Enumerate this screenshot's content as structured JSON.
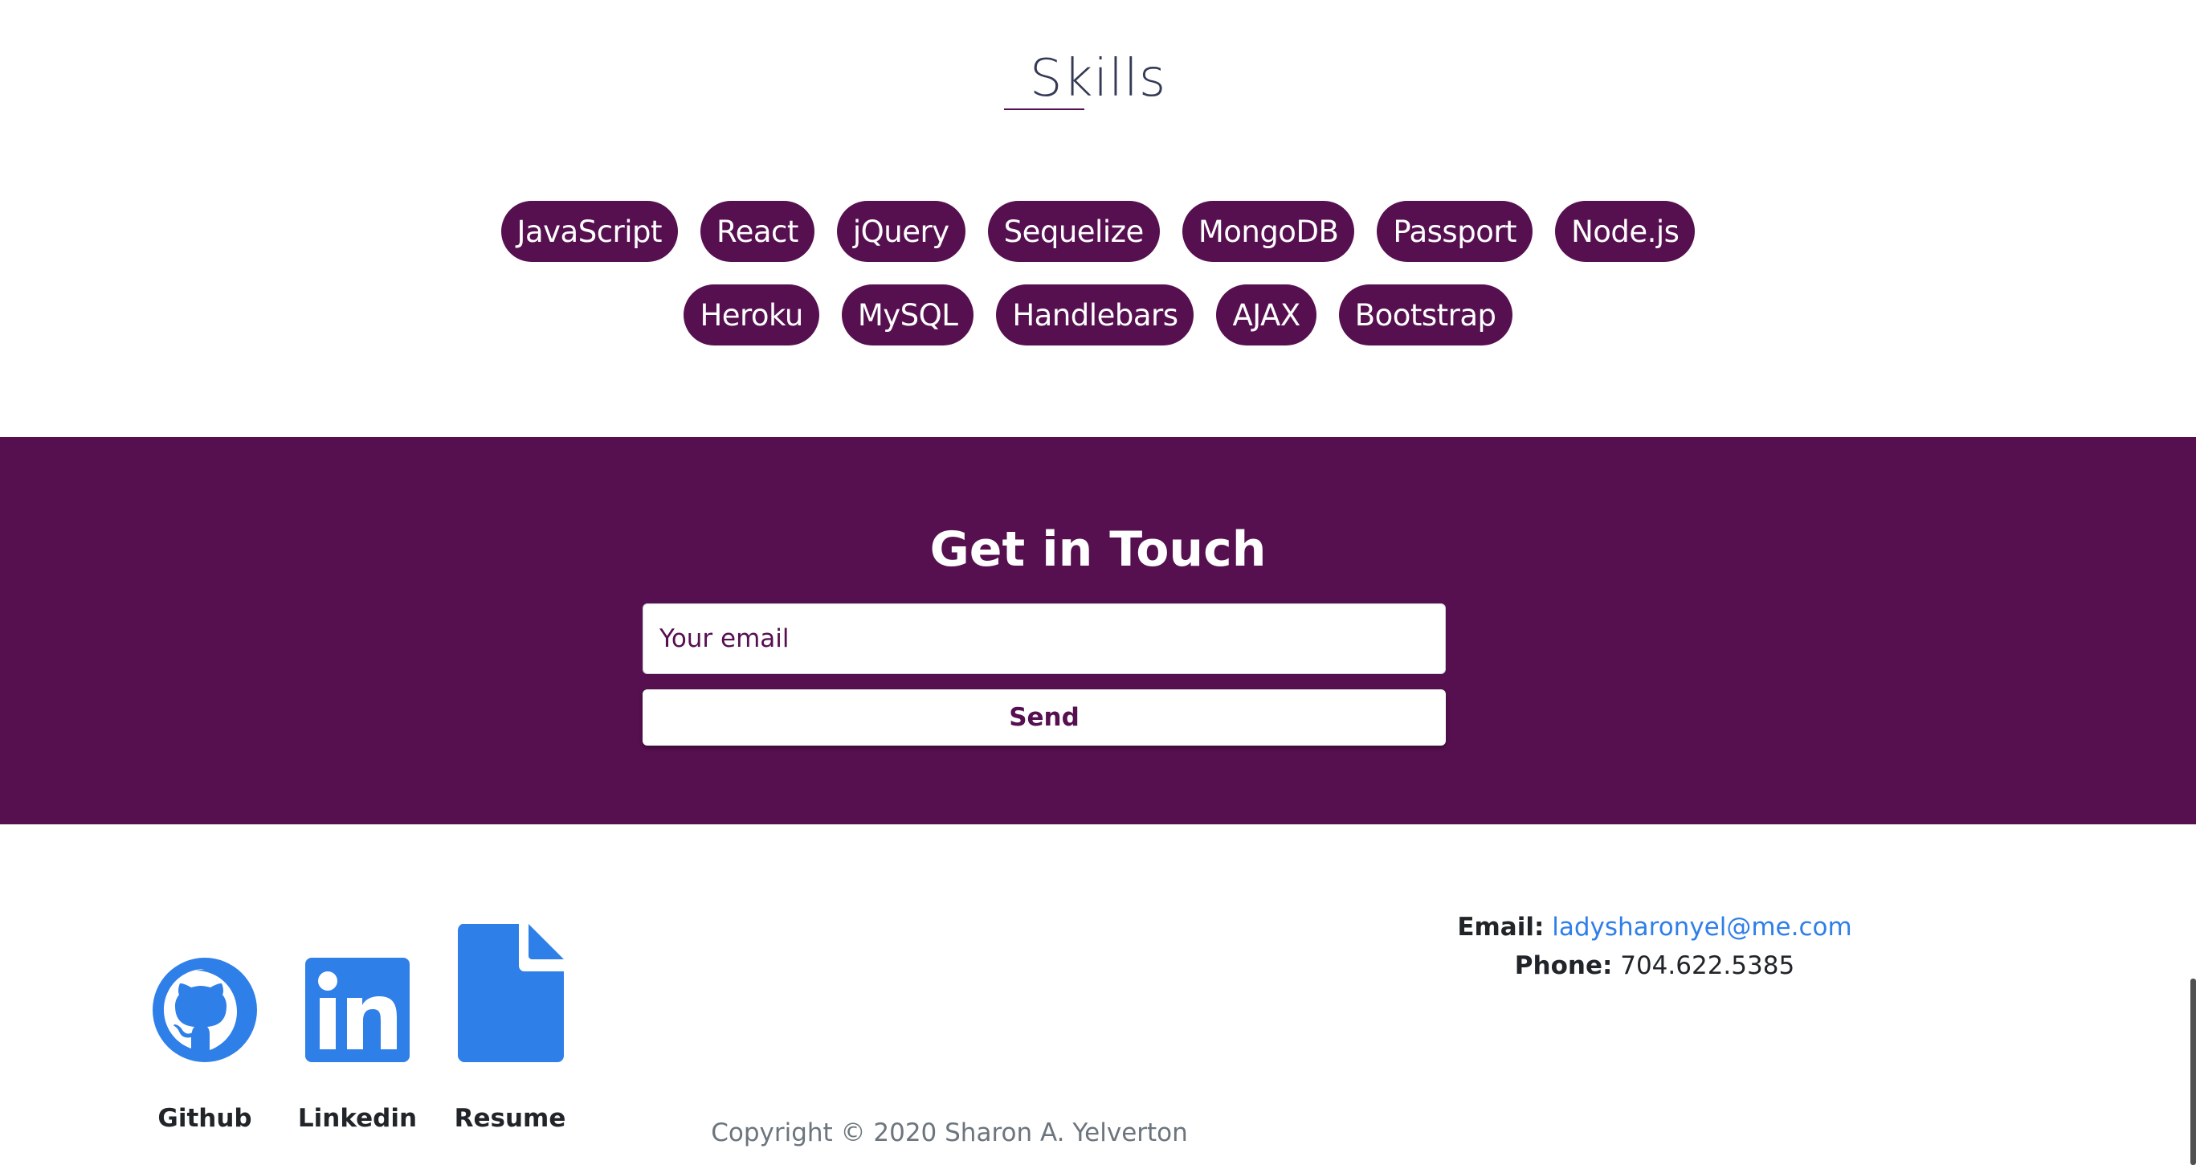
{
  "skills": {
    "title": "Skills",
    "row1": [
      "JavaScript",
      "React",
      "jQuery",
      "Sequelize",
      "MongoDB",
      "Passport",
      "Node.js"
    ],
    "row2": [
      "Heroku",
      "MySQL",
      "Handlebars",
      "AJAX",
      "Bootstrap"
    ]
  },
  "contact": {
    "title": "Get in Touch",
    "email_placeholder": "Your email",
    "send_label": "Send"
  },
  "footer": {
    "links": [
      {
        "label": "Github",
        "icon": "github-icon"
      },
      {
        "label": "Linkedin",
        "icon": "linkedin-icon"
      },
      {
        "label": "Resume",
        "icon": "document-icon"
      }
    ],
    "email_label": "Email:",
    "email_value": "ladysharonyel@me.com",
    "phone_label": "Phone:",
    "phone_value": "704.622.5385",
    "copyright": "Copyright © 2020 Sharon A. Yelverton"
  },
  "colors": {
    "brand": "#561050",
    "icon_blue": "#2f7fe8",
    "link_blue": "#2f7fe8"
  }
}
